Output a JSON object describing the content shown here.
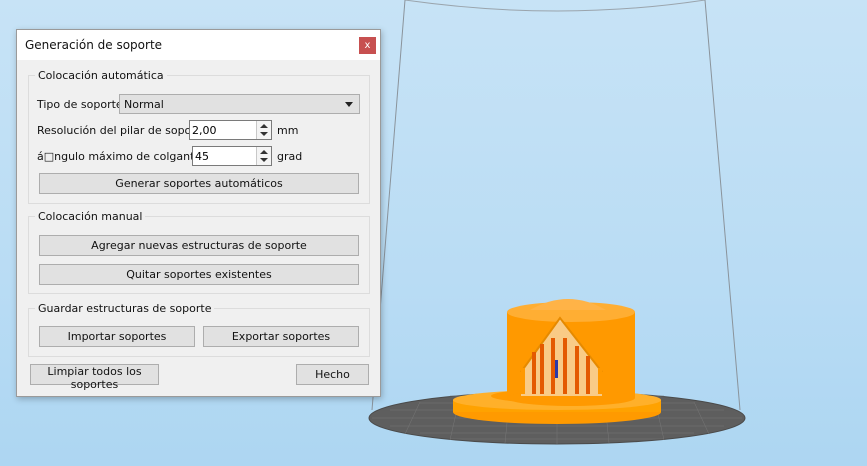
{
  "dialog": {
    "title": "Generación de soporte",
    "close_label": "x",
    "auto": {
      "legend": "Colocación automática",
      "support_type_label": "Tipo de soporte",
      "support_type_value": "Normal",
      "pillar_resolution_label": "Resolución del pilar de soporte",
      "pillar_resolution_value": "2,00",
      "pillar_resolution_unit": "mm",
      "overhang_angle_label": "á□ngulo máximo de colgante",
      "overhang_angle_value": "45",
      "overhang_angle_unit": "grad",
      "generate_button": "Generar soportes automáticos"
    },
    "manual": {
      "legend": "Colocación manual",
      "add_button": "Agregar nuevas estructuras de soporte",
      "remove_button": "Quitar soportes existentes"
    },
    "save": {
      "legend": "Guardar estructuras de soporte",
      "import_button": "Importar soportes",
      "export_button": "Exportar soportes"
    },
    "clear_button": "Limpiar todos los soportes",
    "done_button": "Hecho"
  },
  "colors": {
    "background_top": "#c7e3f6",
    "model": "#ff9900",
    "support": "#e85a00",
    "bed": "#5a5a5a"
  }
}
